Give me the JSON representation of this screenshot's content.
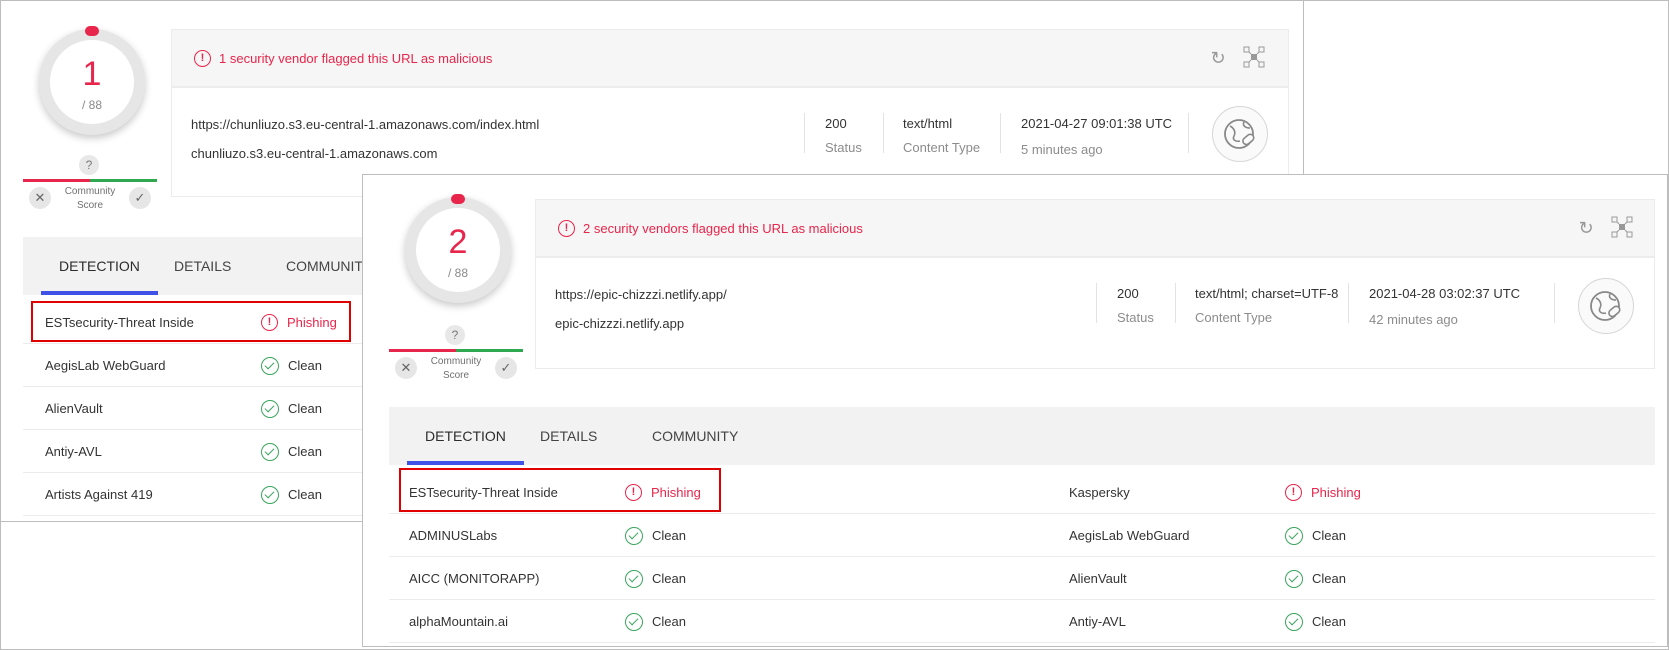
{
  "panel1": {
    "score": "1",
    "score_total": "/ 88",
    "community": {
      "question": "?",
      "label": "Community Score",
      "dislike": "✕",
      "like": "✓"
    },
    "alert": "1 security vendor flagged this URL as malicious",
    "alert_icon": "!",
    "url": "https://chunliuzo.s3.eu-central-1.amazonaws.com/index.html",
    "host": "chunliuzo.s3.eu-central-1.amazonaws.com",
    "status": "200",
    "status_label": "Status",
    "content_type": "text/html",
    "content_type_label": "Content Type",
    "date": "2021-04-27 09:01:38 UTC",
    "ago": "5 minutes ago",
    "tabs": [
      "DETECTION",
      "DETAILS",
      "COMMUNITY"
    ],
    "rows": [
      {
        "vendor": "ESTsecurity-Threat Inside",
        "result": "Phishing"
      },
      {
        "vendor": "AegisLab WebGuard",
        "result": "Clean"
      },
      {
        "vendor": "AlienVault",
        "result": "Clean"
      },
      {
        "vendor": "Antiy-AVL",
        "result": "Clean"
      },
      {
        "vendor": "Artists Against 419",
        "result": "Clean"
      }
    ]
  },
  "panel2": {
    "score": "2",
    "score_total": "/ 88",
    "community": {
      "question": "?",
      "label": "Community Score",
      "dislike": "✕",
      "like": "✓"
    },
    "alert": "2 security vendors flagged this URL as malicious",
    "alert_icon": "!",
    "url": "https://epic-chizzzi.netlify.app/",
    "host": "epic-chizzzi.netlify.app",
    "status": "200",
    "status_label": "Status",
    "content_type": "text/html; charset=UTF-8",
    "content_type_label": "Content Type",
    "date": "2021-04-28 03:02:37 UTC",
    "ago": "42 minutes ago",
    "tabs": [
      "DETECTION",
      "DETAILS",
      "COMMUNITY"
    ],
    "rows_left": [
      {
        "vendor": "ESTsecurity-Threat Inside",
        "result": "Phishing"
      },
      {
        "vendor": "ADMINUSLabs",
        "result": "Clean"
      },
      {
        "vendor": "AICC (MONITORAPP)",
        "result": "Clean"
      },
      {
        "vendor": "alphaMountain.ai",
        "result": "Clean"
      }
    ],
    "rows_right": [
      {
        "vendor": "Kaspersky",
        "result": "Phishing"
      },
      {
        "vendor": "AegisLab WebGuard",
        "result": "Clean"
      },
      {
        "vendor": "AlienVault",
        "result": "Clean"
      },
      {
        "vendor": "Antiy-AVL",
        "result": "Clean"
      }
    ]
  },
  "icons": {
    "refresh": "refresh-icon",
    "graph": "graph-icon",
    "globe": "globe-link-icon",
    "warning": "warning-icon",
    "check": "check-circle-icon"
  },
  "colors": {
    "malicious": "#e8254b",
    "clean": "#3aa55d",
    "tab_active": "#3f51e6",
    "highlight": "#e00000"
  }
}
